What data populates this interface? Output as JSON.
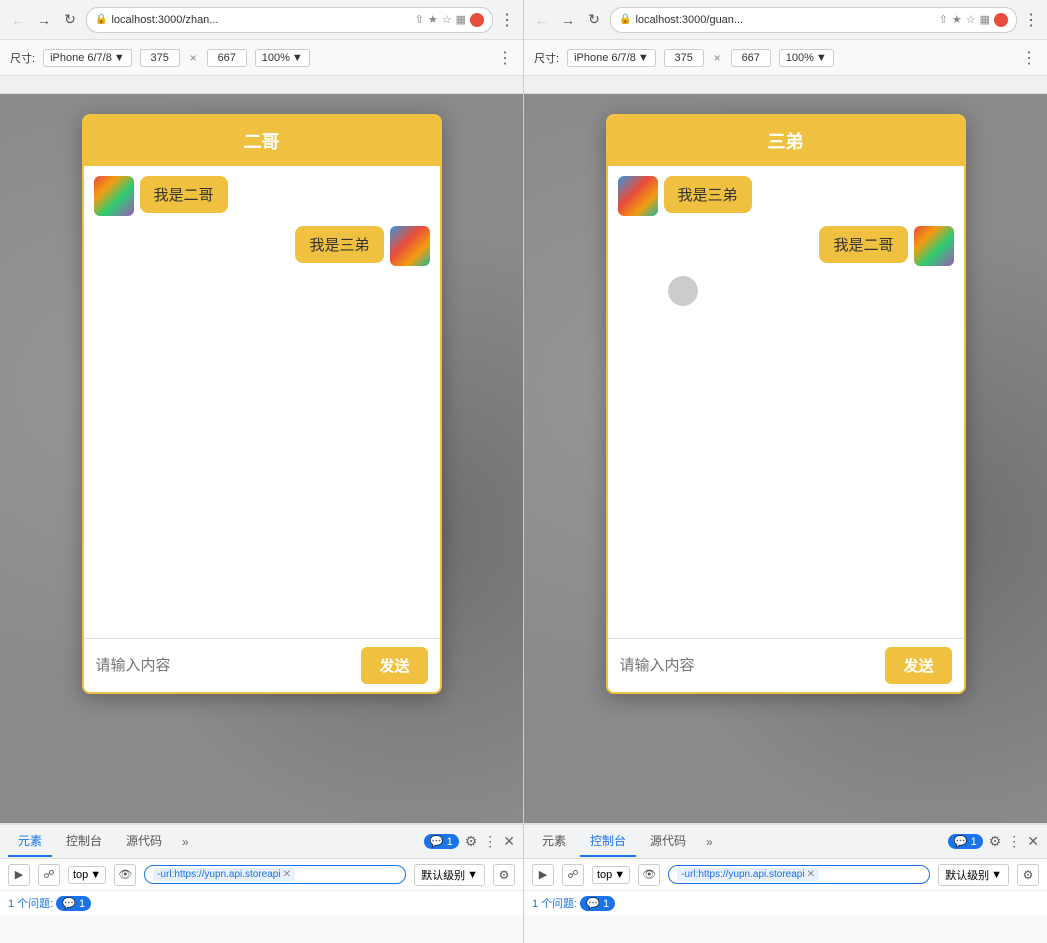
{
  "browser": {
    "left": {
      "url": "localhost:3000/zhan...",
      "back_disabled": false,
      "forward_disabled": false,
      "device": "iPhone 6/7/8",
      "width": "375",
      "height": "667",
      "zoom": "100%"
    },
    "right": {
      "url": "localhost:3000/guan...",
      "device": "iPhone 6/7/8",
      "width": "375",
      "height": "667",
      "zoom": "100%"
    }
  },
  "left_app": {
    "title": "二哥",
    "messages": [
      {
        "sender": "self",
        "text": "我是二哥",
        "align": "left"
      },
      {
        "sender": "other",
        "text": "我是三弟",
        "align": "left"
      }
    ],
    "input_placeholder": "请输入内容",
    "send_label": "发送"
  },
  "right_app": {
    "title": "三弟",
    "messages": [
      {
        "sender": "self",
        "text": "我是三弟",
        "align": "left"
      },
      {
        "sender": "other",
        "text": "我是二哥",
        "align": "right"
      }
    ],
    "input_placeholder": "请输入内容",
    "send_label": "发送"
  },
  "devtools": {
    "left": {
      "tabs": [
        "元素",
        "控制台",
        "源代码"
      ],
      "active_tab": "元素",
      "more_label": "»",
      "badge": "1",
      "top_label": "top",
      "filter_value": "-url:https://yupn.api.storeapi",
      "level_label": "默认级别",
      "issues_label": "1 个问题:",
      "issues_badge": "1"
    },
    "right": {
      "tabs": [
        "元素",
        "控制台",
        "源代码"
      ],
      "active_tab": "控制台",
      "more_label": "»",
      "badge": "1",
      "top_label": "top",
      "filter_value": "-url:https://yupn.api.storeapi",
      "level_label": "默认级别",
      "issues_label": "1 个问题:",
      "issues_badge": "1"
    }
  }
}
